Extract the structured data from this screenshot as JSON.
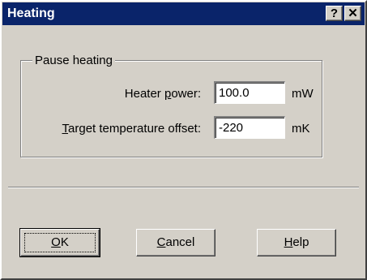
{
  "window": {
    "title": "Heating",
    "help_button": "?",
    "close_button": "✕"
  },
  "group": {
    "legend": "Pause heating",
    "fields": [
      {
        "label_pre": "Heater ",
        "label_mnemonic": "p",
        "label_post": "ower:",
        "value": "100.0",
        "unit": "mW"
      },
      {
        "label_pre": "",
        "label_mnemonic": "T",
        "label_post": "arget temperature offset:",
        "value": "-220",
        "unit": "mK"
      }
    ]
  },
  "buttons": {
    "ok": {
      "mnemonic": "O",
      "rest": "K"
    },
    "cancel": {
      "mnemonic": "C",
      "rest": "ancel"
    },
    "help": {
      "mnemonic": "H",
      "rest": "elp"
    }
  }
}
